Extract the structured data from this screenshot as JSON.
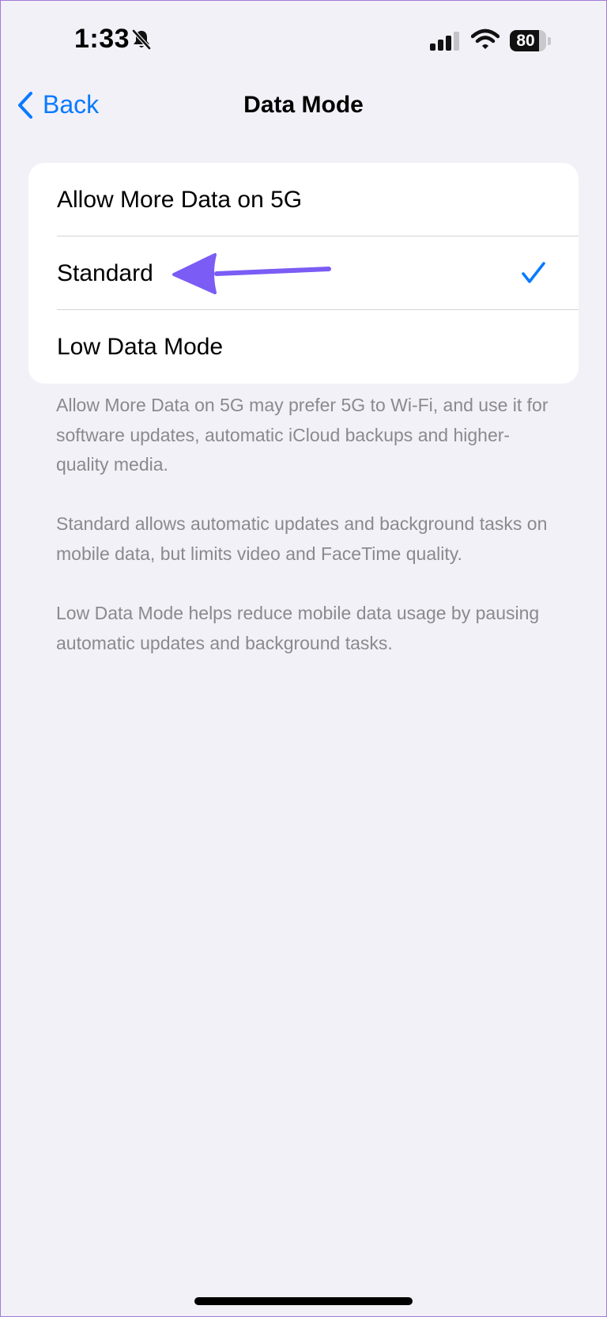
{
  "status_bar": {
    "time": "1:33",
    "battery_level": "80",
    "battery_fraction": 0.8,
    "icons": [
      "bell-slash-icon",
      "cellular-signal-icon",
      "wifi-icon",
      "battery-icon"
    ]
  },
  "nav": {
    "back_label": "Back",
    "title": "Data Mode"
  },
  "options": [
    {
      "label": "Allow More Data on 5G",
      "selected": false
    },
    {
      "label": "Standard",
      "selected": true
    },
    {
      "label": "Low Data Mode",
      "selected": false
    }
  ],
  "descriptions": [
    "Allow More Data on 5G may prefer 5G to Wi-Fi, and use it for software updates, automatic iCloud backups and higher-quality media.",
    "Standard allows automatic updates and background tasks on mobile data, but limits video and FaceTime quality.",
    "Low Data Mode helps reduce mobile data usage by pausing automatic updates and background tasks."
  ],
  "colors": {
    "accent": "#0a7aff",
    "annotation_arrow": "#7b5cf5",
    "background": "#f2f1f7",
    "secondary_text": "#8a8a8e"
  }
}
